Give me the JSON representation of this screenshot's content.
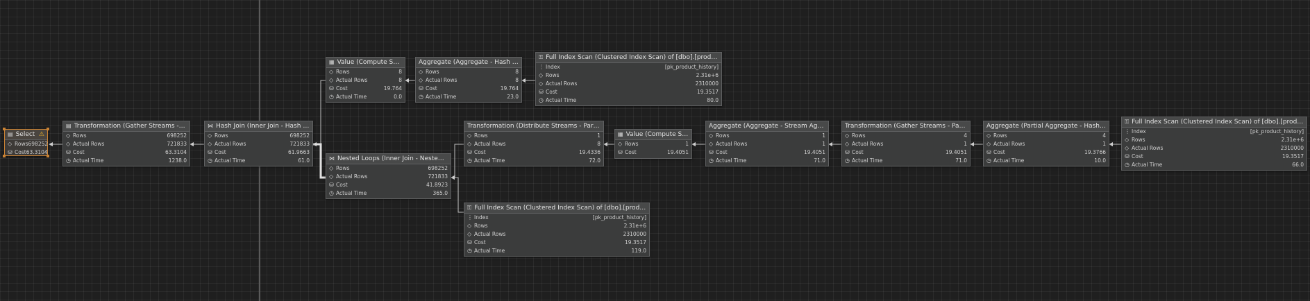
{
  "nodes": {
    "select": {
      "title": "Select",
      "rows": [
        {
          "label": "Rows",
          "value": "698252"
        },
        {
          "label": "Cost",
          "value": "63.3104"
        }
      ]
    },
    "gather1": {
      "title": "Transformation (Gather Streams - Parallelism)",
      "rows": [
        {
          "label": "Rows",
          "value": "698252"
        },
        {
          "label": "Actual Rows",
          "value": "721833"
        },
        {
          "label": "Cost",
          "value": "63.3104"
        },
        {
          "label": "Actual Time",
          "value": "1238.0"
        }
      ]
    },
    "hashjoin": {
      "title": "Hash Join (Inner Join - Hash Match)",
      "rows": [
        {
          "label": "Rows",
          "value": "698252"
        },
        {
          "label": "Actual Rows",
          "value": "721833"
        },
        {
          "label": "Cost",
          "value": "61.9663"
        },
        {
          "label": "Actual Time",
          "value": "61.0"
        }
      ]
    },
    "value1": {
      "title": "Value (Compute Scalar)",
      "rows": [
        {
          "label": "Rows",
          "value": "8"
        },
        {
          "label": "Actual Rows",
          "value": "8"
        },
        {
          "label": "Cost",
          "value": "19.764"
        },
        {
          "label": "Actual Time",
          "value": "0.0"
        }
      ]
    },
    "agg1": {
      "title": "Aggregate (Aggregate - Hash Match)",
      "rows": [
        {
          "label": "Rows",
          "value": "8"
        },
        {
          "label": "Actual Rows",
          "value": "8"
        },
        {
          "label": "Cost",
          "value": "19.764"
        },
        {
          "label": "Actual Time",
          "value": "23.0"
        }
      ]
    },
    "scan1": {
      "title": "Full Index Scan (Clustered Index Scan) of [dbo].[product_history]",
      "rows": [
        {
          "label": "Index",
          "value": "[pk_product_history]"
        },
        {
          "label": "Rows",
          "value": "2.31e+6"
        },
        {
          "label": "Actual Rows",
          "value": "2310000"
        },
        {
          "label": "Cost",
          "value": "19.3517"
        },
        {
          "label": "Actual Time",
          "value": "80.0"
        }
      ]
    },
    "nested": {
      "title": "Nested Loops (Inner Join - Nested Loops)",
      "rows": [
        {
          "label": "Rows",
          "value": "698252"
        },
        {
          "label": "Actual Rows",
          "value": "721833"
        },
        {
          "label": "Cost",
          "value": "41.8923"
        },
        {
          "label": "Actual Time",
          "value": "365.0"
        }
      ]
    },
    "distribute": {
      "title": "Transformation (Distribute Streams - Parallelism)",
      "rows": [
        {
          "label": "Rows",
          "value": "1"
        },
        {
          "label": "Actual Rows",
          "value": "8"
        },
        {
          "label": "Cost",
          "value": "19.4336"
        },
        {
          "label": "Actual Time",
          "value": "72.0"
        }
      ]
    },
    "value2": {
      "title": "Value (Compute Scalar)",
      "rows": [
        {
          "label": "Rows",
          "value": "1"
        },
        {
          "label": "Cost",
          "value": "19.4051"
        }
      ]
    },
    "streamagg": {
      "title": "Aggregate (Aggregate - Stream Aggregate)",
      "rows": [
        {
          "label": "Rows",
          "value": "1"
        },
        {
          "label": "Actual Rows",
          "value": "1"
        },
        {
          "label": "Cost",
          "value": "19.4051"
        },
        {
          "label": "Actual Time",
          "value": "71.0"
        }
      ]
    },
    "gather2": {
      "title": "Transformation (Gather Streams - Parallelism)",
      "rows": [
        {
          "label": "Rows",
          "value": "4"
        },
        {
          "label": "Actual Rows",
          "value": "1"
        },
        {
          "label": "Cost",
          "value": "19.4051"
        },
        {
          "label": "Actual Time",
          "value": "71.0"
        }
      ]
    },
    "partialagg": {
      "title": "Aggregate (Partial Aggregate - Hash Match)",
      "rows": [
        {
          "label": "Rows",
          "value": "4"
        },
        {
          "label": "Actual Rows",
          "value": "1"
        },
        {
          "label": "Cost",
          "value": "19.3766"
        },
        {
          "label": "Actual Time",
          "value": "10.0"
        }
      ]
    },
    "scan2": {
      "title": "Full Index Scan (Clustered Index Scan) of [dbo].[product_history]",
      "rows": [
        {
          "label": "Index",
          "value": "[pk_product_history]"
        },
        {
          "label": "Rows",
          "value": "2.31e+6"
        },
        {
          "label": "Actual Rows",
          "value": "2310000"
        },
        {
          "label": "Cost",
          "value": "19.3517"
        },
        {
          "label": "Actual Time",
          "value": "66.0"
        }
      ]
    },
    "scan3": {
      "title": "Full Index Scan (Clustered Index Scan) of [dbo].[product_history]",
      "rows": [
        {
          "label": "Index",
          "value": "[pk_product_history]"
        },
        {
          "label": "Rows",
          "value": "2.31e+6"
        },
        {
          "label": "Actual Rows",
          "value": "2310000"
        },
        {
          "label": "Cost",
          "value": "19.3517"
        },
        {
          "label": "Actual Time",
          "value": "119.0"
        }
      ]
    }
  },
  "icons": {
    "Rows": "diamond-icon",
    "Actual Rows": "diamond-icon",
    "Cost": "database-icon",
    "Actual Time": "clock-icon",
    "Index": "list-icon"
  },
  "colors": {
    "canvas": "#1f1f1f",
    "node_bg": "#3b3c3c",
    "node_border": "#5f6061",
    "selected_border": "#c98234",
    "warning": "#f0b429",
    "wire": "#bdbdbd"
  }
}
